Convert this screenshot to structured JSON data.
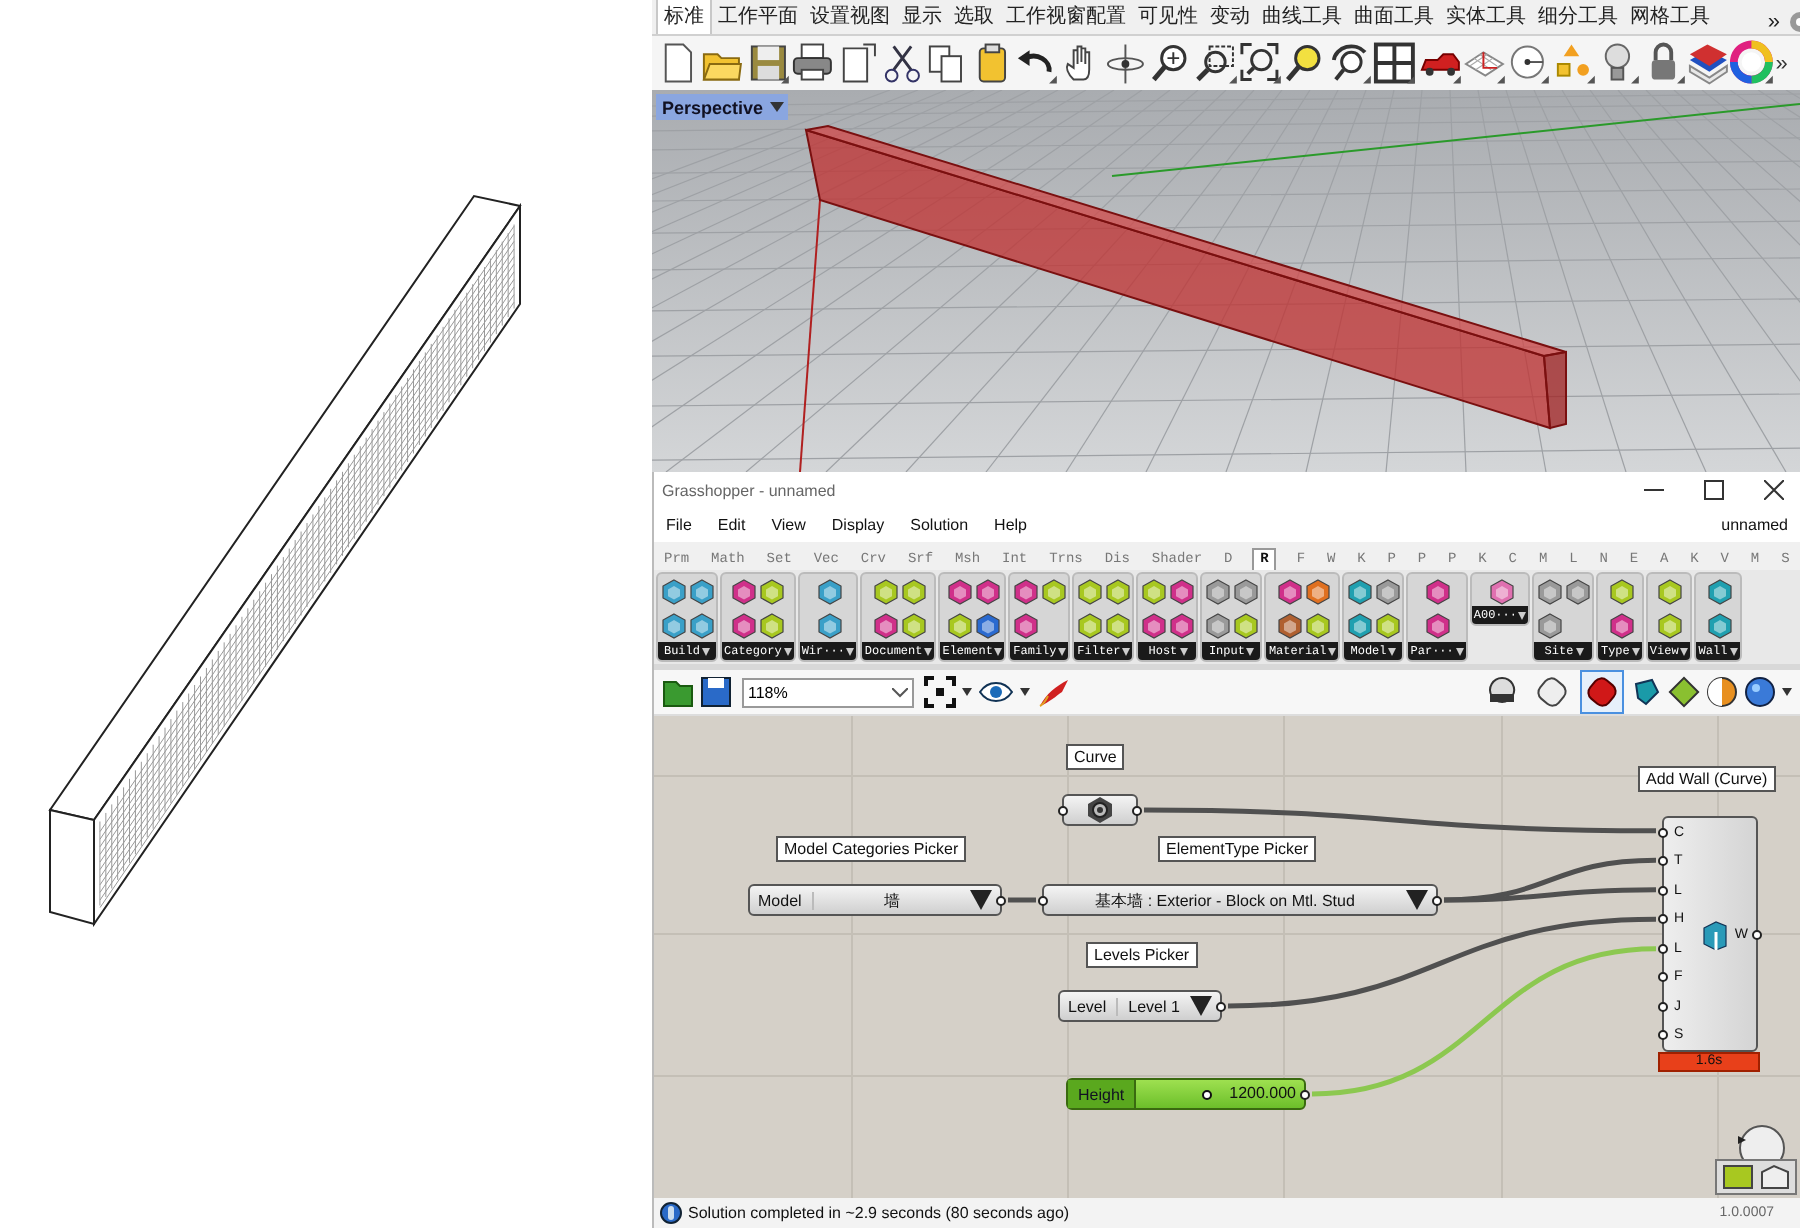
{
  "rhino": {
    "tabs": [
      {
        "label": "标准",
        "selected": true
      },
      {
        "label": "工作平面",
        "selected": false
      },
      {
        "label": "设置视图",
        "selected": false
      },
      {
        "label": "显示",
        "selected": false
      },
      {
        "label": "选取",
        "selected": false
      },
      {
        "label": "工作视窗配置",
        "selected": false
      },
      {
        "label": "可见性",
        "selected": false
      },
      {
        "label": "变动",
        "selected": false
      },
      {
        "label": "曲线工具",
        "selected": false
      },
      {
        "label": "曲面工具",
        "selected": false
      },
      {
        "label": "实体工具",
        "selected": false
      },
      {
        "label": "细分工具",
        "selected": false
      },
      {
        "label": "网格工具",
        "selected": false
      }
    ],
    "tabs_overflow": "»",
    "toolbar_overflow": "»",
    "viewport": {
      "label": "Perspective"
    }
  },
  "grasshopper": {
    "title": "Grasshopper - unnamed",
    "menu": [
      "File",
      "Edit",
      "View",
      "Display",
      "Solution",
      "Help"
    ],
    "document": "unnamed",
    "tabs": [
      {
        "label": "Prm",
        "selected": false
      },
      {
        "label": "Math",
        "selected": false
      },
      {
        "label": "Set",
        "selected": false
      },
      {
        "label": "Vec",
        "selected": false
      },
      {
        "label": "Crv",
        "selected": false
      },
      {
        "label": "Srf",
        "selected": false
      },
      {
        "label": "Msh",
        "selected": false
      },
      {
        "label": "Int",
        "selected": false
      },
      {
        "label": "Trns",
        "selected": false
      },
      {
        "label": "Dis",
        "selected": false
      },
      {
        "label": "Shader",
        "selected": false
      },
      {
        "label": "D",
        "selected": false
      },
      {
        "label": "R",
        "selected": true
      },
      {
        "label": "F",
        "selected": false
      },
      {
        "label": "W",
        "selected": false
      },
      {
        "label": "K",
        "selected": false
      },
      {
        "label": "P",
        "selected": false
      },
      {
        "label": "P",
        "selected": false
      },
      {
        "label": "P",
        "selected": false
      },
      {
        "label": "K",
        "selected": false
      },
      {
        "label": "C",
        "selected": false
      },
      {
        "label": "M",
        "selected": false
      },
      {
        "label": "L",
        "selected": false
      },
      {
        "label": "N",
        "selected": false
      },
      {
        "label": "E",
        "selected": false
      },
      {
        "label": "A",
        "selected": false
      },
      {
        "label": "K",
        "selected": false
      },
      {
        "label": "V",
        "selected": false
      },
      {
        "label": "M",
        "selected": false
      },
      {
        "label": "S",
        "selected": false
      }
    ],
    "ribbon_groups": [
      "Build",
      "Category",
      "Wir···",
      "Document",
      "Element",
      "Family",
      "Filter",
      "Host",
      "Input",
      "Material",
      "Model",
      "Par···",
      "A00···",
      "Site",
      "Type",
      "View",
      "Wall"
    ],
    "zoom": "118%",
    "preview_modes": [
      {
        "selected": false
      },
      {
        "selected": false
      },
      {
        "selected": true
      }
    ],
    "canvas": {
      "curve": {
        "tooltip": "Curve"
      },
      "category_picker": {
        "tooltip": "Model Categories Picker",
        "label": "Model",
        "value": "墙"
      },
      "type_picker": {
        "tooltip": "ElementType Picker",
        "value": "基本墙 : Exterior - Block on Mtl. Stud"
      },
      "level_picker": {
        "tooltip": "Levels Picker",
        "label": "Level",
        "value": "Level 1"
      },
      "slider": {
        "label": "Height",
        "value": "1200.000",
        "level": 0.42
      },
      "component": {
        "tooltip": "Add Wall (Curve)",
        "inputs": [
          "C",
          "T",
          "L",
          "H",
          "L",
          "F",
          "J",
          "S"
        ],
        "output": "W",
        "timing": "1.6s"
      }
    },
    "status_bar": {
      "message": "Solution completed in ~2.9 seconds (80 seconds ago)",
      "version": "1.0.0007"
    }
  }
}
